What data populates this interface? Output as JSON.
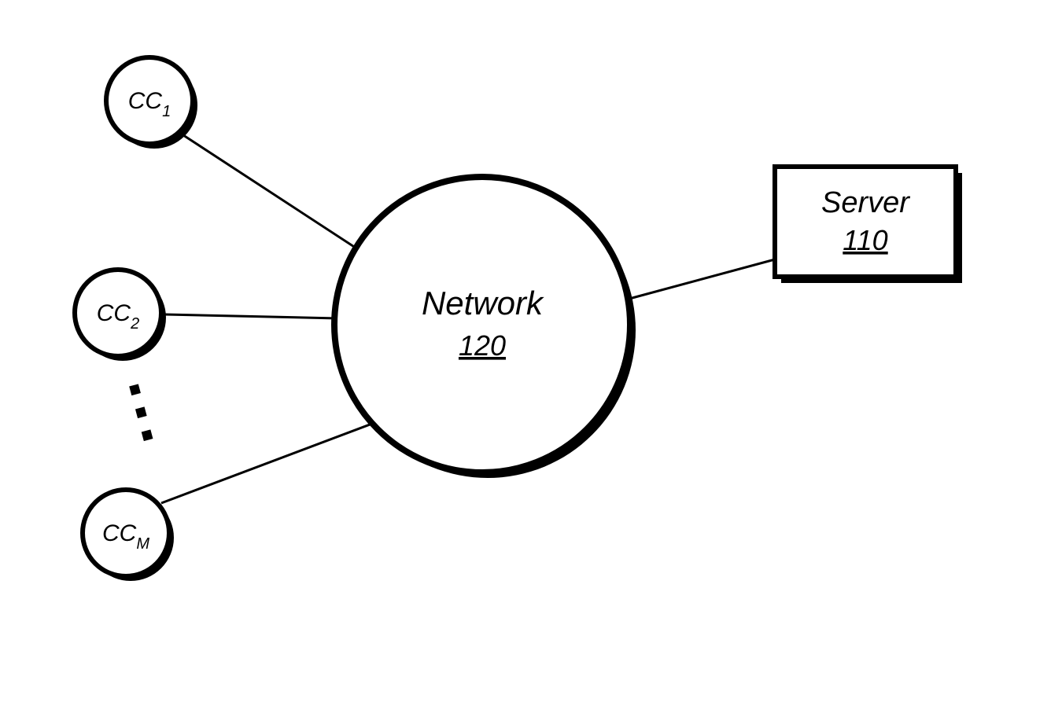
{
  "diagram": {
    "type": "network-topology",
    "nodes": {
      "cc1": {
        "label_main": "CC",
        "label_sub": "1"
      },
      "cc2": {
        "label_main": "CC",
        "label_sub": "2"
      },
      "ccm": {
        "label_main": "CC",
        "label_sub": "M"
      },
      "network": {
        "label": "Network",
        "ref": "120"
      },
      "server": {
        "label": "Server",
        "ref": "110"
      }
    },
    "ellipsis_between_cc2_ccm": "⋮"
  }
}
